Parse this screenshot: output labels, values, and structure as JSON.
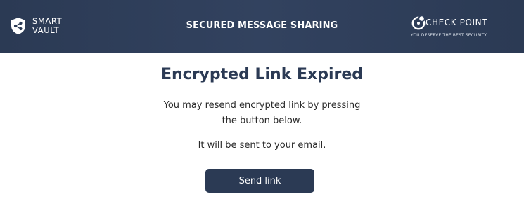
{
  "header": {
    "brand_left": {
      "line1": "SMART",
      "line2": "VAULT",
      "icon": "shield-share-icon"
    },
    "title": "SECURED MESSAGE SHARING",
    "brand_right": {
      "name": "CHECK POINT",
      "tagline": "YOU DESERVE THE BEST SECURITY",
      "icon": "check-point-mark-icon"
    },
    "colors": {
      "background": "#2b3a54",
      "text": "#ffffff"
    }
  },
  "main": {
    "title": "Encrypted Link Expired",
    "message_1": "You may resend encrypted link by pressing the button below.",
    "message_2": "It will be sent to your email.",
    "send_button_label": "Send link",
    "colors": {
      "title": "#2b3a54",
      "button": "#2b3a54",
      "button_text": "#ffffff"
    }
  }
}
